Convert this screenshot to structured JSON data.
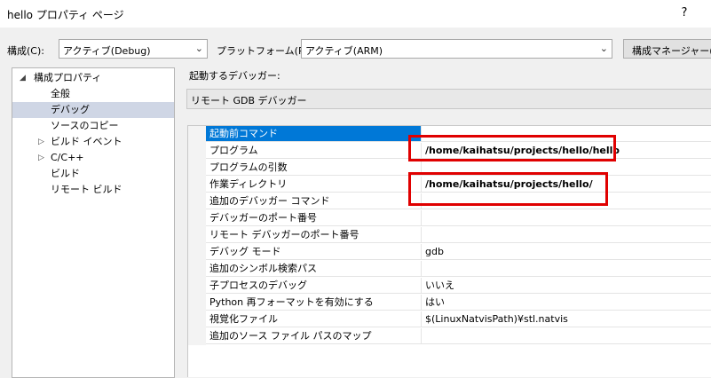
{
  "window": {
    "title": "hello プロパティ ページ",
    "help_label": "?"
  },
  "toolbar": {
    "config_label": "構成(C):",
    "config_value": "アクティブ(Debug)",
    "platform_label": "プラットフォーム(P):",
    "platform_value": "アクティブ(ARM)",
    "config_manager_label": "構成マネージャー(O"
  },
  "tree": {
    "root": "構成プロパティ",
    "items": [
      "全般",
      "デバッグ",
      "ソースのコピー",
      "ビルド イベント",
      "C/C++",
      "ビルド",
      "リモート ビルド"
    ]
  },
  "debugger": {
    "label": "起動するデバッガー:",
    "value": "リモート GDB デバッガー"
  },
  "properties": [
    {
      "name": "起動前コマンド",
      "value": ""
    },
    {
      "name": "プログラム",
      "value": "/home/kaihatsu/projects/hello/hello"
    },
    {
      "name": "プログラムの引数",
      "value": ""
    },
    {
      "name": "作業ディレクトリ",
      "value": "/home/kaihatsu/projects/hello/"
    },
    {
      "name": "追加のデバッガー コマンド",
      "value": ""
    },
    {
      "name": "デバッガーのポート番号",
      "value": ""
    },
    {
      "name": "リモート デバッガーのポート番号",
      "value": ""
    },
    {
      "name": "デバッグ モード",
      "value": "gdb"
    },
    {
      "name": "追加のシンボル検索パス",
      "value": ""
    },
    {
      "name": "子プロセスのデバッグ",
      "value": "いいえ"
    },
    {
      "name": "Python 再フォーマットを有効にする",
      "value": "はい"
    },
    {
      "name": "視覚化ファイル",
      "value": "$(LinuxNatvisPath)¥stl.natvis"
    },
    {
      "name": "追加のソース ファイル パスのマップ",
      "value": ""
    }
  ],
  "icons": {
    "expanded": "triangle-down-icon",
    "collapsed": "triangle-right-icon",
    "dropdown": "chevron-down-icon"
  },
  "colors": {
    "selection": "#0078d7",
    "highlight_box": "#e00000",
    "tree_selection": "#cfd6e5"
  }
}
